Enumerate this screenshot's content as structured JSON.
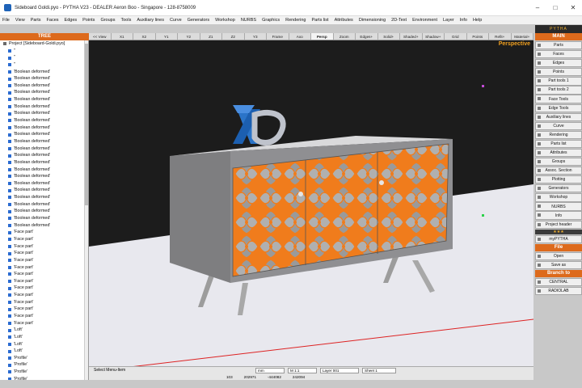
{
  "window": {
    "title": "Sideboard Goldi.pyo - PYTHA V23 - DEALER Aeron Boo - Singapore - 128-8758009"
  },
  "menu": [
    "File",
    "View",
    "Parts",
    "Faces",
    "Edges",
    "Points",
    "Groups",
    "Tools",
    "Auxiliary lines",
    "Curve",
    "Generators",
    "Workshop",
    "NURBS",
    "Graphics",
    "Rendering",
    "Parts list",
    "Attributes",
    "Dimensioning",
    "2D-Text",
    "Environment",
    "Layer",
    "Info",
    "Help"
  ],
  "tree": {
    "header": "TREE",
    "root": "Project [Sideboard-Goldi.pyo]",
    "items": [
      "''",
      "''",
      "''",
      "'Boolean deformed'",
      "'Boolean deformed'",
      "'Boolean deformed'",
      "'Boolean deformed'",
      "'Boolean deformed'",
      "'Boolean deformed'",
      "'Boolean deformed'",
      "'Boolean deformed'",
      "'Boolean deformed'",
      "'Boolean deformed'",
      "'Boolean deformed'",
      "'Boolean deformed'",
      "'Boolean deformed'",
      "'Boolean deformed'",
      "'Boolean deformed'",
      "'Boolean deformed'",
      "'Boolean deformed'",
      "'Boolean deformed'",
      "'Boolean deformed'",
      "'Boolean deformed'",
      "'Boolean deformed'",
      "'Boolean deformed'",
      "'Boolean deformed'",
      "'Face part'",
      "'Face part'",
      "'Face part'",
      "'Face part'",
      "'Face part'",
      "'Face part'",
      "'Face part'",
      "'Face part'",
      "'Face part'",
      "'Face part'",
      "'Face part'",
      "'Face part'",
      "'Face part'",
      "'Face part'",
      "'Loft'",
      "'Loft'",
      "'Loft'",
      "'Loft'",
      "'Profile'",
      "'Profile'",
      "'Profile'",
      "'Profile'"
    ]
  },
  "viewport": {
    "label": "Perspective",
    "toolbar": [
      "<< View",
      "X1",
      "X2",
      "Y1",
      "Y2",
      "Z1",
      "Z2",
      "Y3",
      "Frame",
      "Axo",
      "Persp",
      "Zoom",
      "Edges+",
      "Solid+",
      "Shaded+",
      "Shadow+",
      "Grid",
      "Points",
      "Refit+",
      "Material+"
    ],
    "active_button": "Persp"
  },
  "right_panel": {
    "logo": "PYTHA",
    "header": "MAIN",
    "buttons": [
      "Parts",
      "Faces",
      "Edges",
      "Points",
      "Part tools 1",
      "Part tools 2",
      "Face Tools",
      "Edge Tools",
      "Auxiliary lines",
      "Curve",
      "Rendering",
      "Parts list",
      "Attributes",
      "Groups",
      "Assoc. Section",
      "Plotting",
      "Generators",
      "Workshop",
      "NURBS",
      "Info",
      "Project header"
    ],
    "separator": "★★★",
    "extra": "myPYTHA",
    "file_header": "File",
    "file_buttons": [
      "Open",
      "Save as"
    ],
    "branch_header": "Branch to",
    "branch_buttons": [
      "CENTRAL",
      "RADIOLAB"
    ]
  },
  "status": {
    "hint": "Select Menu-Item",
    "units": "mm",
    "scale": "M 1:1",
    "layer": "Layer 001",
    "sheet": "Sheet 1",
    "coord1": "103",
    "coord2": "202971",
    "coord3": "-444082",
    "coord4": "242094"
  },
  "colors": {
    "accent_orange": "#dd6a1c",
    "panel_orange": "#f07c1c"
  }
}
